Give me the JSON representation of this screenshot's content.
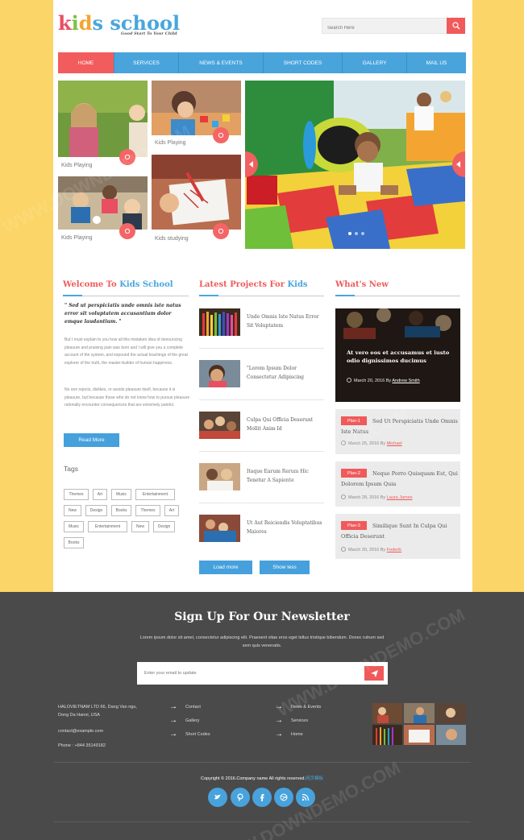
{
  "header": {
    "logo": {
      "k": "k",
      "i": "i",
      "d": "d",
      "s": "s",
      "school": "school"
    },
    "tagline": "Good Start To Your Child",
    "search_placeholder": "Search Here"
  },
  "nav": [
    {
      "label": "HOME",
      "active": true
    },
    {
      "label": "SERVICES",
      "active": false
    },
    {
      "label": "NEWS & EVENTS",
      "active": false
    },
    {
      "label": "SHORT CODES",
      "active": false
    },
    {
      "label": "GALLERY",
      "active": false
    },
    {
      "label": "MAIL US",
      "active": false
    }
  ],
  "tiles": [
    {
      "caption": "Kids Playing"
    },
    {
      "caption": "Kids Playing"
    },
    {
      "caption": "Kids Playing"
    },
    {
      "caption": "Kids studying"
    }
  ],
  "welcome": {
    "title_red": "Welcome To ",
    "title_blue": "Kids School",
    "quote": "\" Sed ut perspiciatis unde omnis iste natus error sit voluptatem accusantium dolor emque laudantium. \"",
    "para1": "But I must explain to you how all this mistaken idea of denouncing pleasure and praising pain was born and I will give you a complete account of the system, and expound the actual teachings of the great explorer of the truth, the master-builder of human happiness.",
    "para2": "No one rejects, dislikes, or avoids pleasure itself, because it is pleasure, but because those who do not know how to pursue pleasure rationally encounter consequences that are extremely painful.",
    "read_more": "Read More"
  },
  "tags": {
    "title": "Tags",
    "items": [
      "Themes",
      "Art",
      "Music",
      "Entertainment",
      "New",
      "Design",
      "Books",
      "Themes",
      "Art",
      "Music",
      "Entertainment",
      "New",
      "Design",
      "Books"
    ]
  },
  "projects": {
    "title_red": "Latest Projects For ",
    "title_blue": "Kids",
    "items": [
      "Unde Omnis Iste Natus Error Sit Voluptatem",
      "\"Lorem Ipsum Dolor Consectetur Adipiscing",
      "Culpa Qui Officia Deserunt Mollit Anim Id",
      "Itaque Earum Rerum Hic Tenetur A Sapiente",
      "Ut Aut Reiciendis Voluptatibus Maiores"
    ],
    "load_more": "Load more",
    "show_less": "Show less"
  },
  "whats_new": {
    "title": "What's New",
    "featured": {
      "title": "At vero eos et accusamus et iusto odio dignissimos ducimus",
      "date": "March 20, 2016 By ",
      "author": "Andrew Smith"
    },
    "items": [
      {
        "plan": "Plan-1",
        "title": "Sed Ut Perspiciatis Unde Omnis Iste Natus",
        "date": "March 25, 2016 By ",
        "author": "Michael"
      },
      {
        "plan": "Plan-2",
        "title": "Neque Porro Quisquam Est, Qui Dolorem Ipsum Quia",
        "date": "March 28, 2016 By ",
        "author": "Laura James"
      },
      {
        "plan": "Plan-3",
        "title": "Similique Sunt In Culpa Qui Officia Deserunt",
        "date": "March 30, 2016 By ",
        "author": "Federik"
      }
    ]
  },
  "footer": {
    "newsletter_title": "Sign Up For Our Newsletter",
    "newsletter_sub": "Lorem ipsum dolor sit amet, consectetur adipiscing elit. Praesent vitae eros eget tellus tristique bibendum. Donec rutrum sed sem quis venenatis.",
    "email_placeholder": "Enter your email to update",
    "address1": "HALOVIETNAM LTD 66, Dang Van ngu,",
    "address2": "Dong Da Hanoi, USA",
    "email": "contact@example.com",
    "phone": "Phone : +844 35149182",
    "links_col1": [
      "Contact",
      "Gallery",
      "Short Codes"
    ],
    "links_col2": [
      "News & Events",
      "Services",
      "Home"
    ],
    "copyright": "Copyright © 2016.Company name All rights reserved.",
    "copyright_link": "网页模板"
  },
  "social": [
    "twitter-icon",
    "pinterest-icon",
    "facebook-icon",
    "dribbble-icon",
    "rss-icon"
  ],
  "watermark": "WWW.DOWNDEMO.COM",
  "colors": {
    "accent_red": "#f05a5a",
    "accent_blue": "#49a4dc",
    "bg_yellow": "#fbd567",
    "footer_bg": "#4a4a4a"
  }
}
